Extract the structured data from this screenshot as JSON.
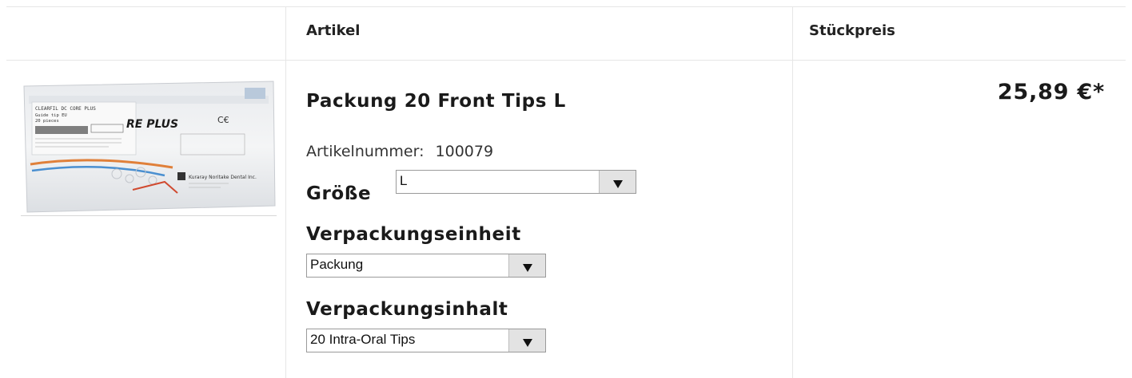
{
  "header": {
    "col_article": "Artikel",
    "col_unit_price": "Stückpreis"
  },
  "product": {
    "title": "Packung 20 Front Tips L",
    "article_number_label": "Artikelnummer:",
    "article_number": "100079",
    "image_alt": "CLEARFIL DC CORE PLUS Guide tip package",
    "image_text": {
      "line1": "CLEARFIL DC CORE PLUS",
      "line2": "Guide tip EU",
      "line3": "20 pieces",
      "brand_wordmark": "RE PLUS",
      "maker": "Kuraray Noritake Dental Inc."
    },
    "size_label": "Größe",
    "size_value": "L",
    "packaging_unit_label": "Verpackungseinheit",
    "packaging_unit_value": "Packung",
    "packaging_content_label": "Verpackungsinhalt",
    "packaging_content_value": "20 Intra-Oral Tips",
    "price": "25,89 €*"
  },
  "colors": {
    "border": "#e6e6e6",
    "text": "#1a1a1a",
    "select_button": "#e3e3e3"
  }
}
